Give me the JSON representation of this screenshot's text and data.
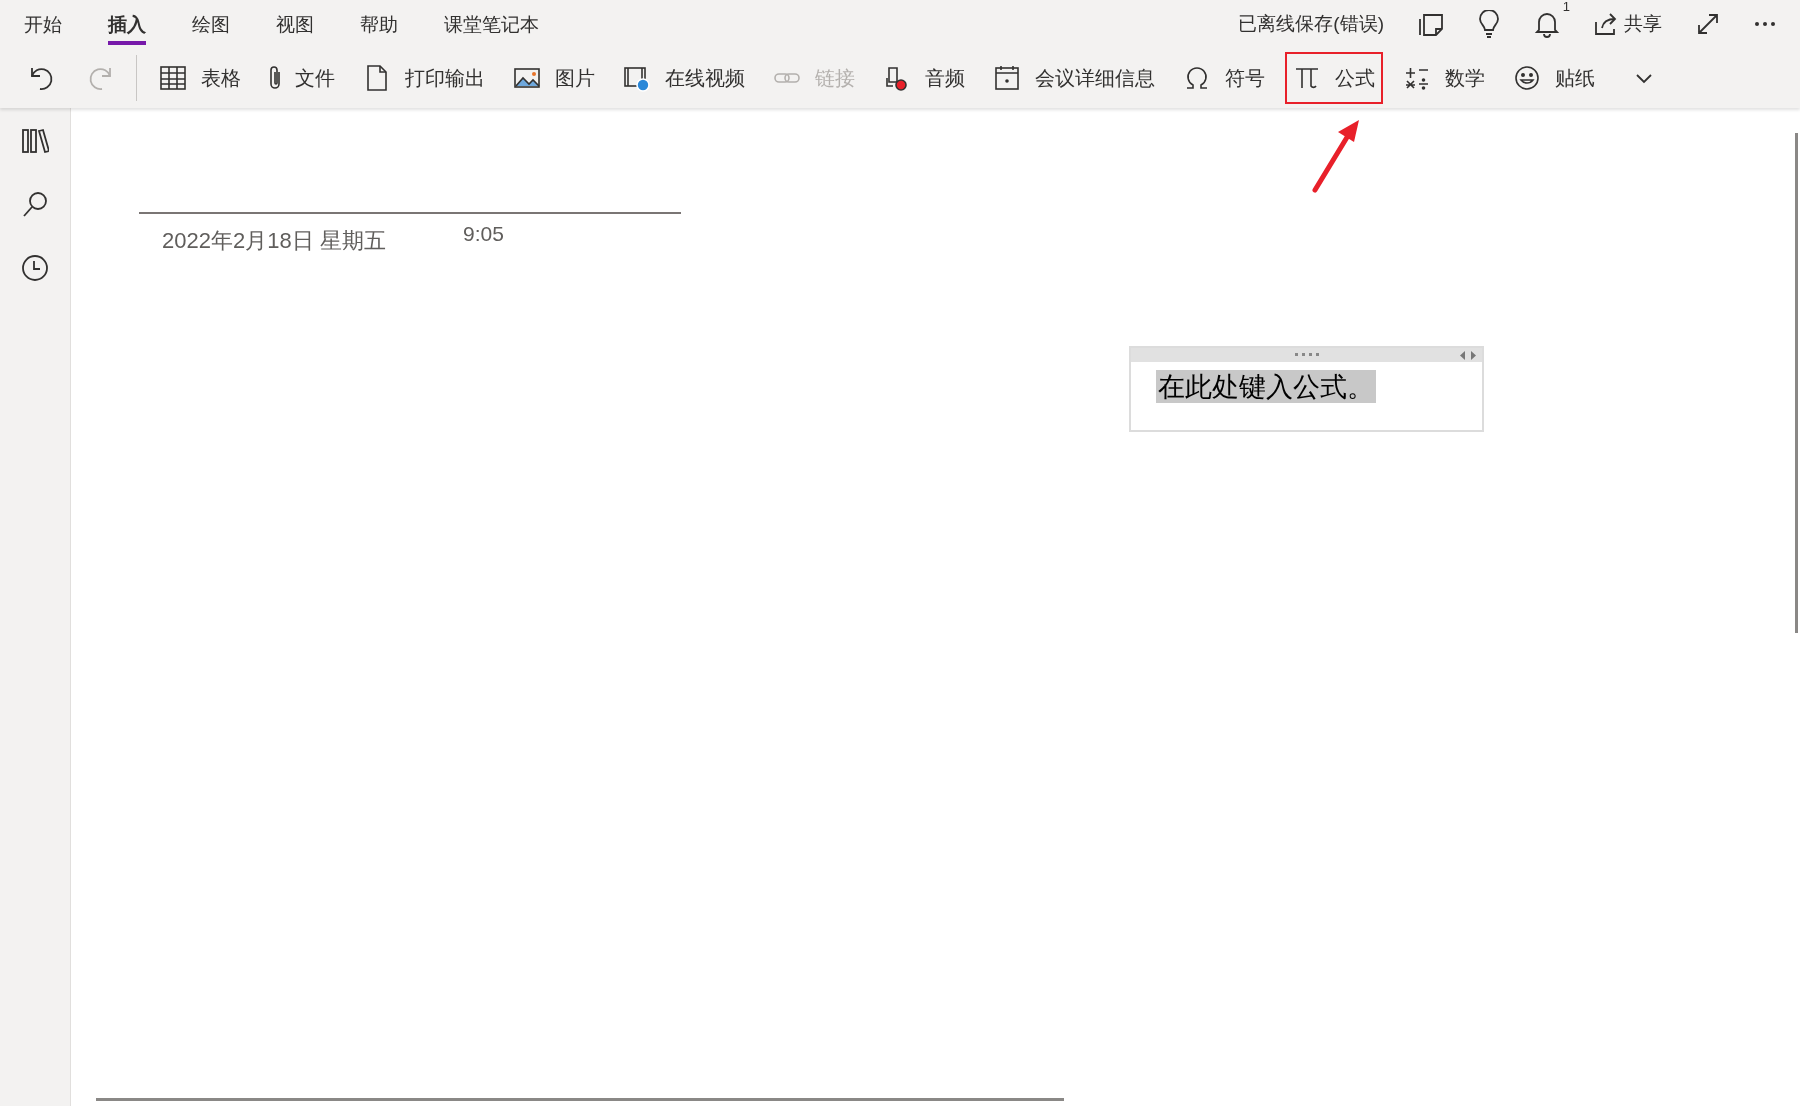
{
  "menu_tabs": [
    {
      "label": "开始",
      "selected": false
    },
    {
      "label": "插入",
      "selected": true
    },
    {
      "label": "绘图",
      "selected": false
    },
    {
      "label": "视图",
      "selected": false
    },
    {
      "label": "帮助",
      "selected": false
    },
    {
      "label": "课堂笔记本",
      "selected": false
    }
  ],
  "save_status": "已离线保存(错误)",
  "notification_count": "1",
  "share_label": "共享",
  "toolbar": [
    {
      "label": "表格",
      "disabled": false,
      "highlighted": false
    },
    {
      "label": "文件",
      "disabled": false,
      "highlighted": false
    },
    {
      "label": "打印输出",
      "disabled": false,
      "highlighted": false
    },
    {
      "label": "图片",
      "disabled": false,
      "highlighted": false
    },
    {
      "label": "在线视频",
      "disabled": false,
      "highlighted": false
    },
    {
      "label": "链接",
      "disabled": true,
      "highlighted": false
    },
    {
      "label": "音频",
      "disabled": false,
      "highlighted": false
    },
    {
      "label": "会议详细信息",
      "disabled": false,
      "highlighted": false
    },
    {
      "label": "符号",
      "disabled": false,
      "highlighted": false
    },
    {
      "label": "公式",
      "disabled": false,
      "highlighted": true
    },
    {
      "label": "数学",
      "disabled": false,
      "highlighted": false
    },
    {
      "label": "贴纸",
      "disabled": false,
      "highlighted": false
    }
  ],
  "page": {
    "date": "2022年2月18日 星期五",
    "time": "9:05",
    "equation_placeholder": "在此处键入公式。"
  }
}
